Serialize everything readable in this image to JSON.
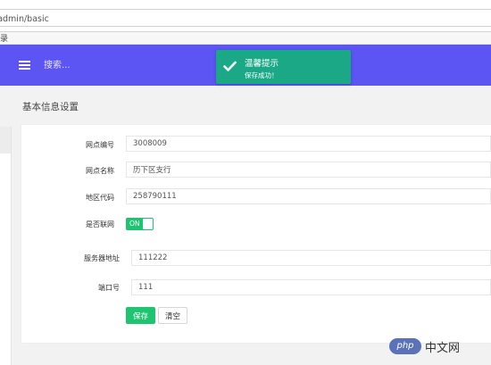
{
  "browser": {
    "url": "/admin/basic",
    "menu_fragment": "录"
  },
  "topbar": {
    "menu_icon": "hamburger-menu-icon",
    "search_placeholder": "搜索...",
    "color": "#5c54f3"
  },
  "toast": {
    "title": "温馨提示",
    "message": "保存成功！",
    "icon": "check-icon",
    "color": "#1aa886"
  },
  "page": {
    "title": "基本信息设置"
  },
  "form": {
    "fields": [
      {
        "label": "网点编号",
        "value": "3008009"
      },
      {
        "label": "网点名称",
        "value": "历下区支行"
      },
      {
        "label": "地区代码",
        "value": "258790111"
      },
      {
        "label": "是否联网",
        "toggle_text": "ON",
        "checked": true
      },
      {
        "label": "服务器地址",
        "value": "111222"
      },
      {
        "label": "端口号",
        "value": "111"
      }
    ],
    "save_label": "保存",
    "clear_label": "清空",
    "accent": "#1fc470"
  },
  "watermark": {
    "logo_text": "php",
    "site_text": "中文网"
  }
}
